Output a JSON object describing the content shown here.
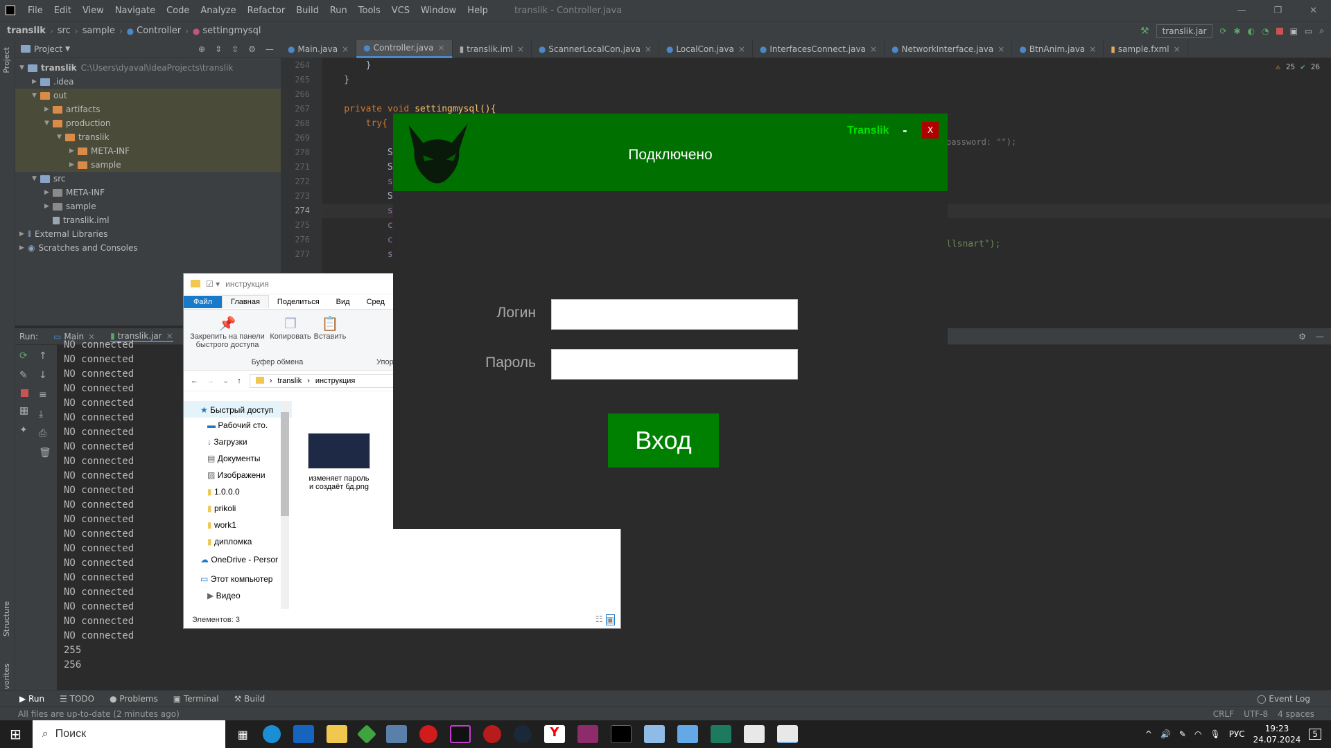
{
  "menubar": {
    "items": [
      "File",
      "Edit",
      "View",
      "Navigate",
      "Code",
      "Analyze",
      "Refactor",
      "Build",
      "Run",
      "Tools",
      "VCS",
      "Window",
      "Help"
    ],
    "title": "translik - Controller.java"
  },
  "navbar": {
    "crumbs": [
      "translik",
      "src",
      "sample",
      "Controller",
      "settingmysql"
    ],
    "run_config": "translik.jar"
  },
  "project": {
    "header": "Project",
    "root_label": "translik",
    "root_path": "C:\\Users\\dyaval\\IdeaProjects\\translik",
    "rows": [
      ".idea",
      "out",
      "artifacts",
      "production",
      "translik",
      "META-INF",
      "sample",
      "src",
      "META-INF",
      "sample",
      "translik.iml",
      "External Libraries",
      "Scratches and Consoles"
    ]
  },
  "editor": {
    "tabs": [
      "Main.java",
      "Controller.java",
      "translik.iml",
      "ScannerLocalCon.java",
      "LocalCon.java",
      "InterfacesConnect.java",
      "NetworkInterface.java",
      "BtnAnim.java",
      "sample.fxml"
    ],
    "warnings": "25",
    "checks": "26",
    "line_numbers": [
      "264",
      "265",
      "266",
      "267",
      "268",
      "269",
      "270",
      "271",
      "272",
      "273",
      "274",
      "275",
      "276",
      "277"
    ],
    "lines": {
      "l264": "        }",
      "l265": "    }",
      "l266": "",
      "l267a": "    private void ",
      "l267b": "settingmysql(){",
      "l268a": "        ",
      "l268b": "try{",
      "l270": "            Stat",
      "l271": "            Syst",
      "l272": "            sql.",
      "l273": "            Syst",
      "l274": "            sql.",
      "l275": "            conn",
      "l276": "            conn",
      "l277": "            sql="
    },
    "code_right_1": "password: \"\");",
    "code_right_2": "llsnart\");"
  },
  "run": {
    "label": "Run:",
    "tabs": [
      "Main",
      "translik.jar"
    ],
    "console": [
      "NO connected",
      "NO connected",
      "NO connected",
      "NO connected",
      "NO connected",
      "NO connected",
      "NO connected",
      "NO connected",
      "NO connected",
      "NO connected",
      "NO connected",
      "NO connected",
      "NO connected",
      "NO connected",
      "NO connected",
      "NO connected",
      "NO connected",
      "NO connected",
      "NO connected",
      "NO connected",
      "NO connected",
      "255",
      "256"
    ]
  },
  "bottom_tools": [
    "Run",
    "TODO",
    "Problems",
    "Terminal",
    "Build"
  ],
  "event_log": "Event Log",
  "status": {
    "message": "All files are up-to-date (2 minutes ago)",
    "right": [
      "CRLF",
      "UTF-8",
      "4 spaces"
    ]
  },
  "side_labels": [
    "Project",
    "Structure",
    "Favorites"
  ],
  "explorer": {
    "title": "инструкция",
    "ribbon_tabs": [
      "Файл",
      "Главная",
      "Поделиться",
      "Вид",
      "Сред"
    ],
    "pin_label": "Закрепить на панели быстрого доступа",
    "copy_label": "Копировать",
    "paste_label": "Вставить",
    "group_label": "Буфер обмена",
    "group2_label": "Упор",
    "path": [
      "translik",
      "инструкция"
    ],
    "nav_items": [
      "Быстрый доступ",
      "Рабочий сто.",
      "Загрузки",
      "Документы",
      "Изображени",
      "1.0.0.0",
      "prikoli",
      "work1",
      "дипломка",
      "OneDrive - Persor",
      "Этот компьютер",
      "Видео"
    ],
    "file_name": "изменяет пароль и создаёт бд.png",
    "status": "Элементов: 3"
  },
  "translik_app": {
    "title": "Translik",
    "dash": "-",
    "close": "X",
    "status": "Подключено",
    "login_label": "Логин",
    "password_label": "Пароль",
    "login_value": "",
    "password_value": "",
    "submit": "Вход",
    "header_color": "#007000",
    "button_color": "#008000"
  },
  "taskbar": {
    "search_placeholder": "Поиск",
    "lang": "РУС",
    "time": "19:23",
    "date": "24.07.2024",
    "notifications": "5"
  }
}
